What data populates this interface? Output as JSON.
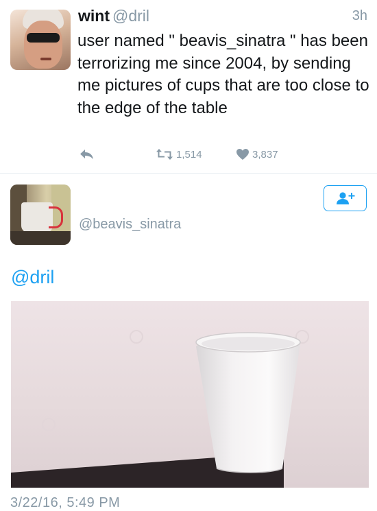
{
  "tweet": {
    "display_name": "wint",
    "handle": "@dril",
    "time_ago": "3h",
    "text": "user named \" beavis_sinatra \" has been terrorizing me since 2004, by sending me pictures of cups that are too close to the edge of the table",
    "retweets": "1,514",
    "likes": "3,837",
    "icons": {
      "reply": "reply-icon",
      "retweet": "retweet-icon",
      "like": "heart-icon"
    }
  },
  "reply_tweet": {
    "handle": "@beavis_sinatra",
    "text": "@dril",
    "datetime": "3/22/16, 5:49 PM",
    "follow_icon": "add-user-icon"
  },
  "colors": {
    "link_blue": "#1da1f2",
    "muted_gray": "#8899a6",
    "text_dark": "#14171a",
    "divider": "#e6ecf0"
  }
}
